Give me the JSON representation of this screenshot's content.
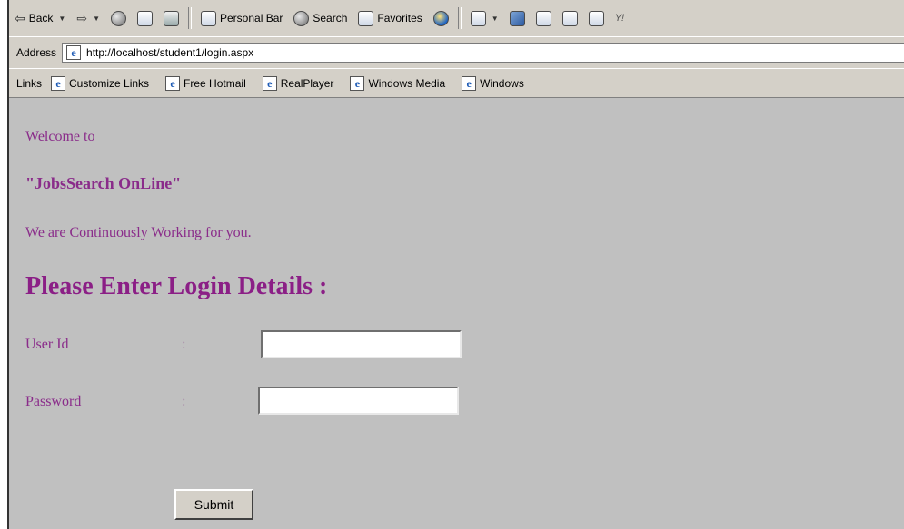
{
  "toolbar": {
    "back_label": "Back",
    "personal_bar_label": "Personal Bar",
    "search_label": "Search",
    "favorites_label": "Favorites"
  },
  "address": {
    "label": "Address",
    "url": "http://localhost/student1/login.aspx"
  },
  "links_bar": {
    "label": "Links",
    "items": [
      {
        "label": "Customize Links"
      },
      {
        "label": "Free Hotmail"
      },
      {
        "label": "RealPlayer"
      },
      {
        "label": "Windows Media"
      },
      {
        "label": "Windows"
      }
    ]
  },
  "page": {
    "welcome": "Welcome to",
    "brand": "\"JobsSearch OnLine\"",
    "tagline": "We are Continuously Working for you.",
    "heading": "Please Enter Login Details :",
    "user_id_label": "User Id",
    "password_label": "Password",
    "colon": ":",
    "user_id_value": "",
    "password_value": "",
    "submit_label": "Submit"
  },
  "colors": {
    "page_background": "#c0c0c0",
    "text_purple": "#8a2c8a",
    "chrome_gray": "#d4d0c8"
  }
}
